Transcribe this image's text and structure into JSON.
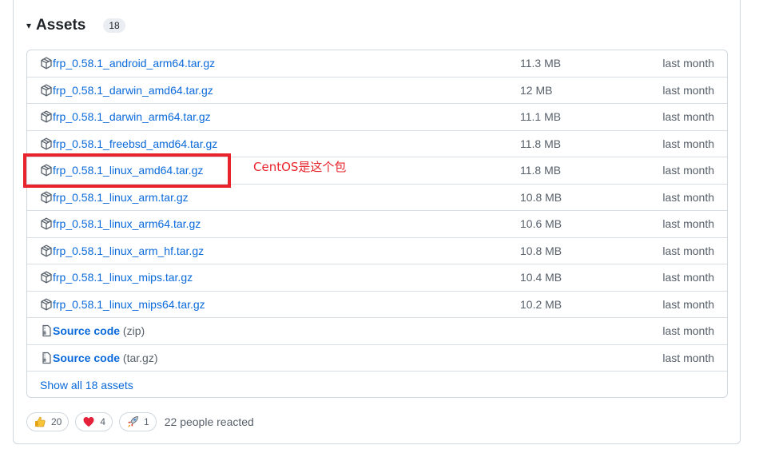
{
  "assets": {
    "caret": "▾",
    "title": "Assets",
    "count": "18",
    "files": [
      {
        "name": "frp_0.58.1_android_arm64.tar.gz",
        "size": "11.3 MB",
        "date": "last month"
      },
      {
        "name": "frp_0.58.1_darwin_amd64.tar.gz",
        "size": "12 MB",
        "date": "last month"
      },
      {
        "name": "frp_0.58.1_darwin_arm64.tar.gz",
        "size": "11.1 MB",
        "date": "last month"
      },
      {
        "name": "frp_0.58.1_freebsd_amd64.tar.gz",
        "size": "11.8 MB",
        "date": "last month"
      },
      {
        "name": "frp_0.58.1_linux_amd64.tar.gz",
        "size": "11.8 MB",
        "date": "last month"
      },
      {
        "name": "frp_0.58.1_linux_arm.tar.gz",
        "size": "10.8 MB",
        "date": "last month"
      },
      {
        "name": "frp_0.58.1_linux_arm64.tar.gz",
        "size": "10.6 MB",
        "date": "last month"
      },
      {
        "name": "frp_0.58.1_linux_arm_hf.tar.gz",
        "size": "10.8 MB",
        "date": "last month"
      },
      {
        "name": "frp_0.58.1_linux_mips.tar.gz",
        "size": "10.4 MB",
        "date": "last month"
      },
      {
        "name": "frp_0.58.1_linux_mips64.tar.gz",
        "size": "10.2 MB",
        "date": "last month"
      }
    ],
    "source": [
      {
        "label": "Source code",
        "ext": "(zip)",
        "date": "last month"
      },
      {
        "label": "Source code",
        "ext": "(tar.gz)",
        "date": "last month"
      }
    ],
    "show_all": "Show all 18 assets"
  },
  "annotation": {
    "text": "CentOS是这个包",
    "color": "#e8232b"
  },
  "reactions": {
    "items": [
      {
        "icon": "thumbs-up-icon",
        "count": "20"
      },
      {
        "icon": "heart-icon",
        "count": "4"
      },
      {
        "icon": "rocket-icon",
        "count": "1"
      }
    ],
    "summary": "22 people reacted"
  },
  "colors": {
    "link": "#0969da",
    "muted": "#57606a",
    "border": "#d0d7de"
  }
}
